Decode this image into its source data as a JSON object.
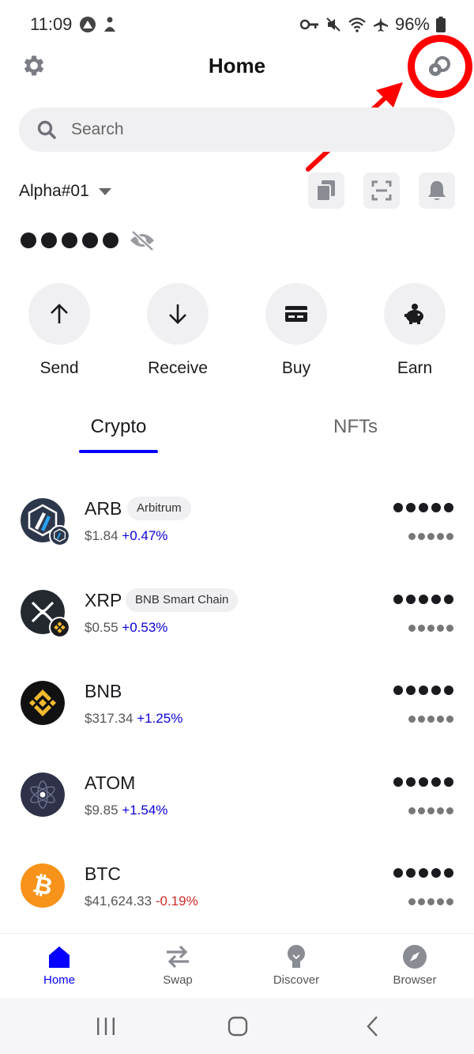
{
  "status_bar": {
    "time": "11:09",
    "battery": "96%"
  },
  "header": {
    "title": "Home"
  },
  "search": {
    "placeholder": "Search"
  },
  "wallet": {
    "name": "Alpha#01"
  },
  "actions": [
    {
      "label": "Send",
      "icon": "arrow-up-icon"
    },
    {
      "label": "Receive",
      "icon": "arrow-down-icon"
    },
    {
      "label": "Buy",
      "icon": "card-icon"
    },
    {
      "label": "Earn",
      "icon": "piggy-bank-icon"
    }
  ],
  "tabs": [
    {
      "label": "Crypto",
      "active": true
    },
    {
      "label": "NFTs",
      "active": false
    }
  ],
  "assets": [
    {
      "symbol": "ARB",
      "chain": "Arbitrum",
      "price": "$1.84",
      "change": "+0.47%",
      "direction": "up"
    },
    {
      "symbol": "XRP",
      "chain": "BNB Smart Chain",
      "price": "$0.55",
      "change": "+0.53%",
      "direction": "up"
    },
    {
      "symbol": "BNB",
      "chain": "",
      "price": "$317.34",
      "change": "+1.25%",
      "direction": "up"
    },
    {
      "symbol": "ATOM",
      "chain": "",
      "price": "$9.85",
      "change": "+1.54%",
      "direction": "up"
    },
    {
      "symbol": "BTC",
      "chain": "",
      "price": "$41,624.33",
      "change": "-0.19%",
      "direction": "down"
    }
  ],
  "bottom_nav": [
    {
      "label": "Home",
      "active": true
    },
    {
      "label": "Swap",
      "active": false
    },
    {
      "label": "Discover",
      "active": false
    },
    {
      "label": "Browser",
      "active": false
    }
  ],
  "colors": {
    "accent": "#0500ff",
    "positive": "#0a00d8",
    "negative": "#d12b2b",
    "annotation": "#ff0000"
  }
}
